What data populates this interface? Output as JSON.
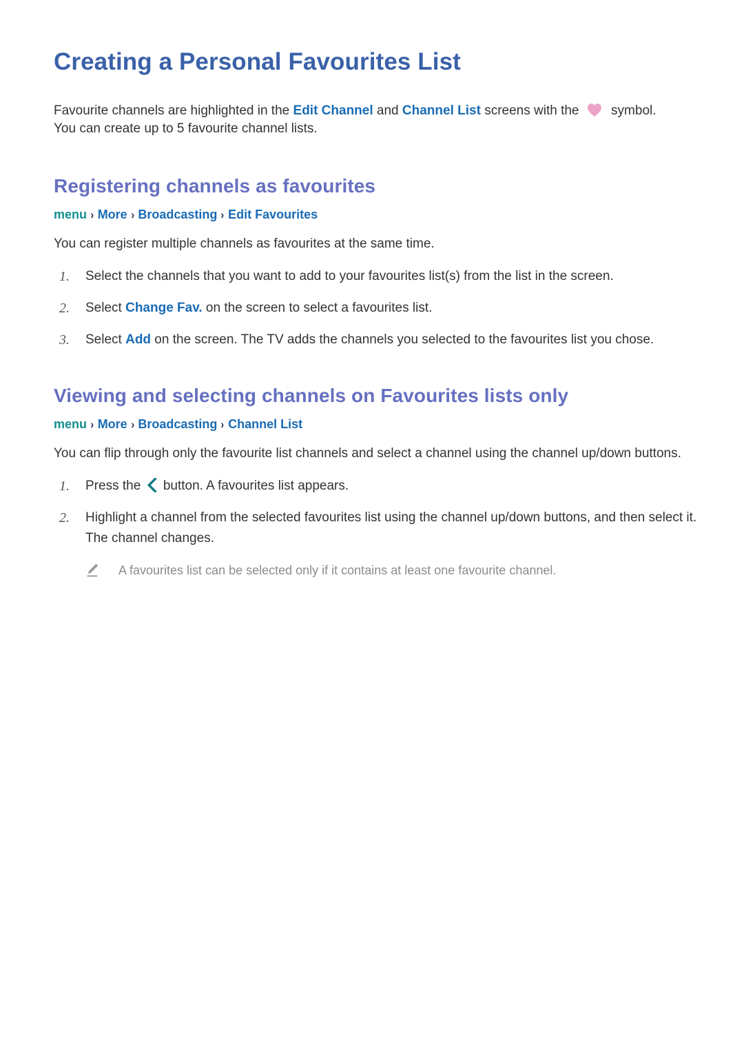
{
  "document": {
    "title": "Creating a Personal Favourites List",
    "intro": {
      "part1": "Favourite channels are highlighted in the ",
      "link1": "Edit Channel",
      "part2": " and ",
      "link2": "Channel List",
      "part3": " screens with the ",
      "part4": " symbol.",
      "line2": "You can create up to 5 favourite channel lists."
    }
  },
  "colors": {
    "title_blue": "#3a61a8",
    "heading_violet": "#6670c0",
    "link_blue": "#1a6bb5",
    "breadcrumb_menu_teal": "#148f8f",
    "breadcrumb_separator": "#1c2a4a",
    "heart_pink": "#eda3c8",
    "back_button_teal": "#147a86",
    "note_gray": "#8c8c8c",
    "body_text": "#333333",
    "background": "#ffffff"
  },
  "icons": {
    "heart": "heart-icon",
    "back_chevron": "back-chevron-icon",
    "note_pencil": "pencil-note-icon",
    "breadcrumb_chevron": "chevron-right-icon"
  },
  "section1": {
    "heading": "Registering channels as favourites",
    "breadcrumb": {
      "menu": "menu",
      "separator": "›",
      "items": [
        "More",
        "Broadcasting",
        "Edit Favourites"
      ]
    },
    "lead": "You can register multiple channels as favourites at the same time.",
    "steps": [
      {
        "number": "1.",
        "text": "Select the channels that you want to add to your favourites list(s) from the list in the screen."
      },
      {
        "number": "2.",
        "prefix": "Select ",
        "link": "Change Fav.",
        "suffix": " on the screen to select a favourites list."
      },
      {
        "number": "3.",
        "prefix": "Select ",
        "link": "Add",
        "suffix": " on the screen. The TV adds the channels you selected to the favourites list you chose."
      }
    ]
  },
  "section2": {
    "heading": "Viewing and selecting channels on Favourites lists only",
    "breadcrumb": {
      "menu": "menu",
      "separator": "›",
      "items": [
        "More",
        "Broadcasting",
        "Channel List"
      ]
    },
    "lead": "You can flip through only the favourite list channels and select a channel using the channel up/down buttons.",
    "steps": [
      {
        "number": "1.",
        "prefix": "Press the ",
        "suffix": " button. A favourites list appears."
      },
      {
        "number": "2.",
        "text": "Highlight a channel from the selected favourites list using the channel up/down buttons, and then select it. The channel changes."
      }
    ],
    "note": "A favourites list can be selected only if it contains at least one favourite channel."
  }
}
